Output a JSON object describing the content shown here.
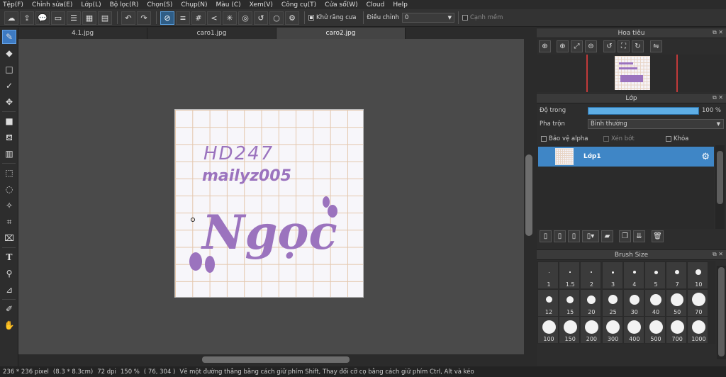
{
  "menu": [
    "Tệp(F)",
    "Chỉnh sửa(E)",
    "Lớp(L)",
    "Bộ lọc(R)",
    "Chọn(S)",
    "Chụp(N)",
    "Màu (C)",
    "Xem(V)",
    "Công cụ(T)",
    "Cửa sổ(W)",
    "Cloud",
    "Help"
  ],
  "toolbar": {
    "antialias_label": "Khử răng cưa",
    "adjust_label": "Điều chỉnh",
    "adjust_value": "0",
    "smooth_label": "Cạnh mềm"
  },
  "tabs": [
    "4.1.jpg",
    "caro1.jpg",
    "caro2.jpg"
  ],
  "canvas_text": {
    "line1": "HD247",
    "line2": "mailyz005",
    "line3": "Ngọc"
  },
  "navigator": {
    "title": "Hoa tiêu"
  },
  "layer_panel": {
    "title": "Lớp",
    "opacity_label": "Độ trong",
    "opacity_value": "100 %",
    "opacity_fraction": 1.0,
    "blend_label": "Pha trộn",
    "blend_value": "Bình thường",
    "protect_alpha": "Bảo vệ alpha",
    "clip": "Xén bớt",
    "lock": "Khóa",
    "layer_name": "Lớp1"
  },
  "brush_panel": {
    "title": "Brush Size",
    "sizes": [
      "1",
      "1.5",
      "2",
      "3",
      "4",
      "5",
      "7",
      "10",
      "12",
      "15",
      "20",
      "25",
      "30",
      "40",
      "50",
      "70",
      "100",
      "150",
      "200",
      "300",
      "400",
      "500",
      "700",
      "1000"
    ]
  },
  "status": {
    "size": "236 * 236 pixel",
    "cm": "(8.3 * 8.3cm)",
    "dpi": "72 dpi",
    "zoom": "150 %",
    "coords": "( 76, 304 )",
    "hint": "Vẽ một đường thẳng bằng cách giữ phím Shift, Thay đổi cỡ cọ bằng cách giữ phím Ctrl, Alt và kéo"
  },
  "colors": {
    "accent": "#3f86c6",
    "ink": "#9b73be",
    "grid": "#e4c7ad"
  }
}
